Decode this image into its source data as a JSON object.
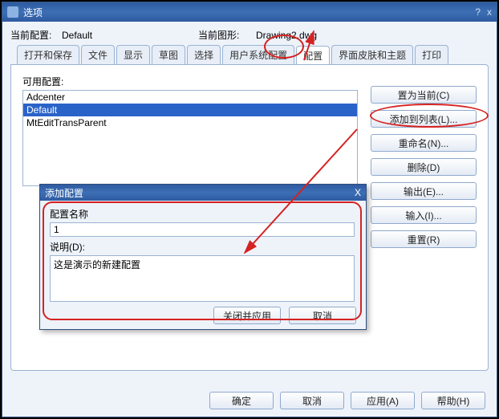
{
  "window": {
    "title": "选项",
    "help_glyph": "?",
    "close_glyph": "x"
  },
  "info": {
    "current_profile_label": "当前配置:",
    "current_profile_value": "Default",
    "current_drawing_label": "当前图形:",
    "current_drawing_value": "Drawing2.dwg"
  },
  "tabs": {
    "items": [
      {
        "label": "打开和保存"
      },
      {
        "label": "文件"
      },
      {
        "label": "显示"
      },
      {
        "label": "草图"
      },
      {
        "label": "选择"
      },
      {
        "label": "用户系统配置"
      },
      {
        "label": "配置"
      },
      {
        "label": "界面皮肤和主题"
      },
      {
        "label": "打印"
      }
    ]
  },
  "profiles": {
    "available_label": "可用配置:",
    "items": [
      {
        "name": "Adcenter",
        "selected": false
      },
      {
        "name": "Default",
        "selected": true
      },
      {
        "name": "MtEditTransParent",
        "selected": false
      }
    ]
  },
  "buttons": {
    "set_current": "置为当前(C)",
    "add_to_list": "添加到列表(L)...",
    "rename": "重命名(N)...",
    "delete": "删除(D)",
    "export": "输出(E)...",
    "import": "输入(I)...",
    "reset": "重置(R)"
  },
  "modal": {
    "title": "添加配置",
    "close_glyph": "X",
    "name_label": "配置名称",
    "name_value": "1",
    "desc_label": "说明(D):",
    "desc_value": "这是演示的新建配置",
    "close_apply": "关闭并应用",
    "cancel": "取消"
  },
  "footer": {
    "ok": "确定",
    "cancel": "取消",
    "apply": "应用(A)",
    "help": "帮助(H)"
  }
}
